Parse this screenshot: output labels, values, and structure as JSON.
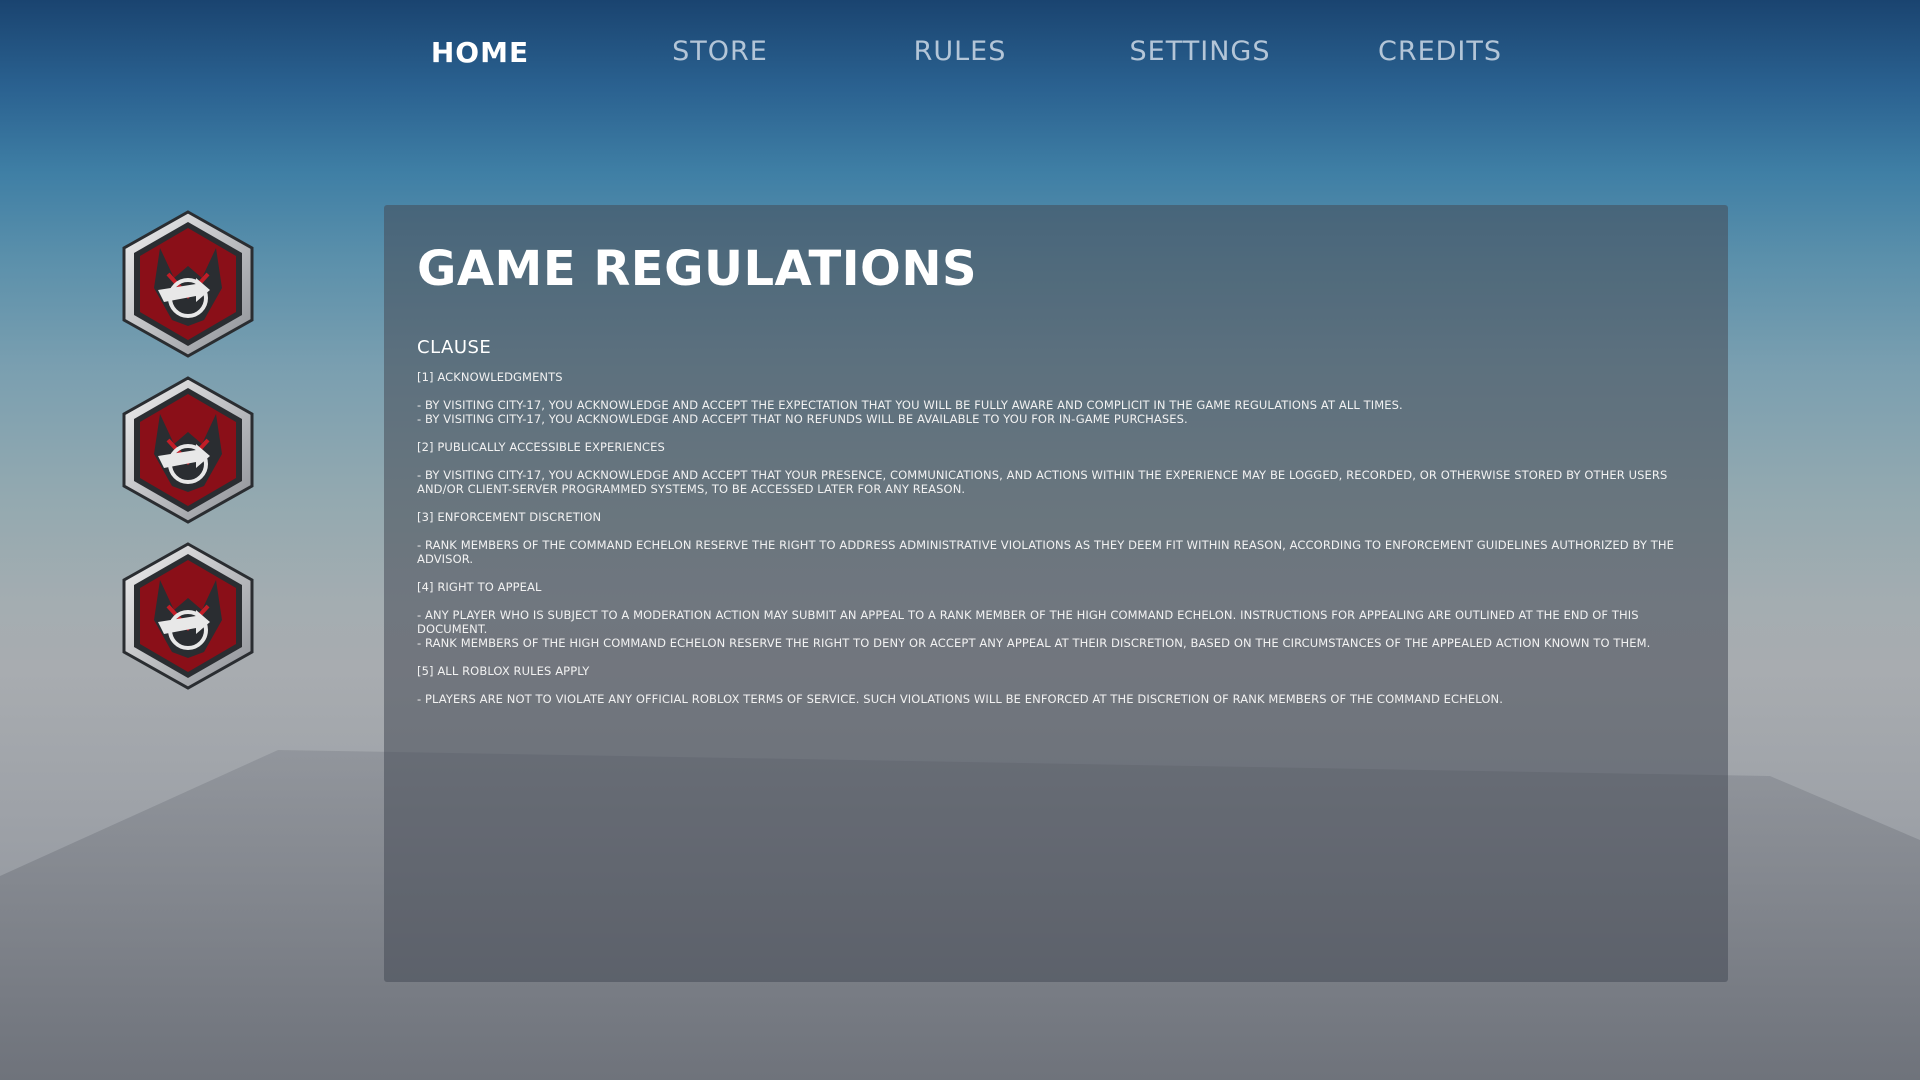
{
  "nav": {
    "items": [
      {
        "label": "HOME",
        "active": true
      },
      {
        "label": "STORE",
        "active": false
      },
      {
        "label": "RULES",
        "active": false
      },
      {
        "label": "SETTINGS",
        "active": false
      },
      {
        "label": "CREDITS",
        "active": false
      }
    ]
  },
  "badges": [
    {
      "icon": "faction-emblem-icon"
    },
    {
      "icon": "faction-emblem-icon"
    },
    {
      "icon": "faction-emblem-icon"
    }
  ],
  "panel": {
    "title": "GAME REGULATIONS",
    "subtitle": "CLAUSE",
    "clauses": [
      {
        "heading": "[1] ACKNOWLEDGMENTS",
        "lines": [
          "- BY VISITING CITY-17, YOU ACKNOWLEDGE AND ACCEPT THE EXPECTATION THAT YOU WILL BE FULLY AWARE AND COMPLICIT IN THE GAME REGULATIONS AT ALL TIMES.",
          "- BY VISITING CITY-17, YOU ACKNOWLEDGE AND ACCEPT THAT NO REFUNDS WILL BE AVAILABLE TO YOU FOR IN-GAME PURCHASES."
        ]
      },
      {
        "heading": "[2] PUBLICALLY ACCESSIBLE EXPERIENCES",
        "lines": [
          "- BY VISITING CITY-17, YOU ACKNOWLEDGE AND ACCEPT THAT YOUR PRESENCE, COMMUNICATIONS, AND ACTIONS WITHIN THE EXPERIENCE MAY BE LOGGED, RECORDED, OR OTHERWISE STORED BY OTHER USERS AND/OR CLIENT-SERVER PROGRAMMED SYSTEMS, TO BE ACCESSED LATER FOR ANY REASON."
        ]
      },
      {
        "heading": "[3] ENFORCEMENT DISCRETION",
        "lines": [
          "- RANK MEMBERS OF THE COMMAND ECHELON RESERVE THE RIGHT TO ADDRESS ADMINISTRATIVE VIOLATIONS AS THEY DEEM FIT WITHIN REASON, ACCORDING TO ENFORCEMENT GUIDELINES AUTHORIZED BY THE ADVISOR."
        ]
      },
      {
        "heading": "[4] RIGHT TO APPEAL",
        "lines": [
          "- ANY PLAYER WHO IS SUBJECT TO A MODERATION ACTION MAY SUBMIT AN APPEAL TO A RANK MEMBER OF THE HIGH COMMAND ECHELON. INSTRUCTIONS FOR APPEALING ARE OUTLINED AT THE END OF THIS DOCUMENT.",
          "- RANK MEMBERS OF THE HIGH COMMAND ECHELON RESERVE THE RIGHT TO DENY OR ACCEPT ANY APPEAL AT THEIR DISCRETION, BASED ON THE CIRCUMSTANCES OF THE APPEALED ACTION KNOWN TO THEM."
        ]
      },
      {
        "heading": "[5] ALL ROBLOX RULES APPLY",
        "lines": [
          "- PLAYERS ARE NOT TO VIOLATE ANY OFFICIAL ROBLOX TERMS OF SERVICE. SUCH VIOLATIONS WILL BE ENFORCED AT THE DISCRETION OF RANK MEMBERS OF THE COMMAND ECHELON."
        ]
      }
    ]
  },
  "colors": {
    "emblem_red": "#8a0f18",
    "emblem_dark": "#2a2d31",
    "emblem_rim": "#d9dadc"
  }
}
